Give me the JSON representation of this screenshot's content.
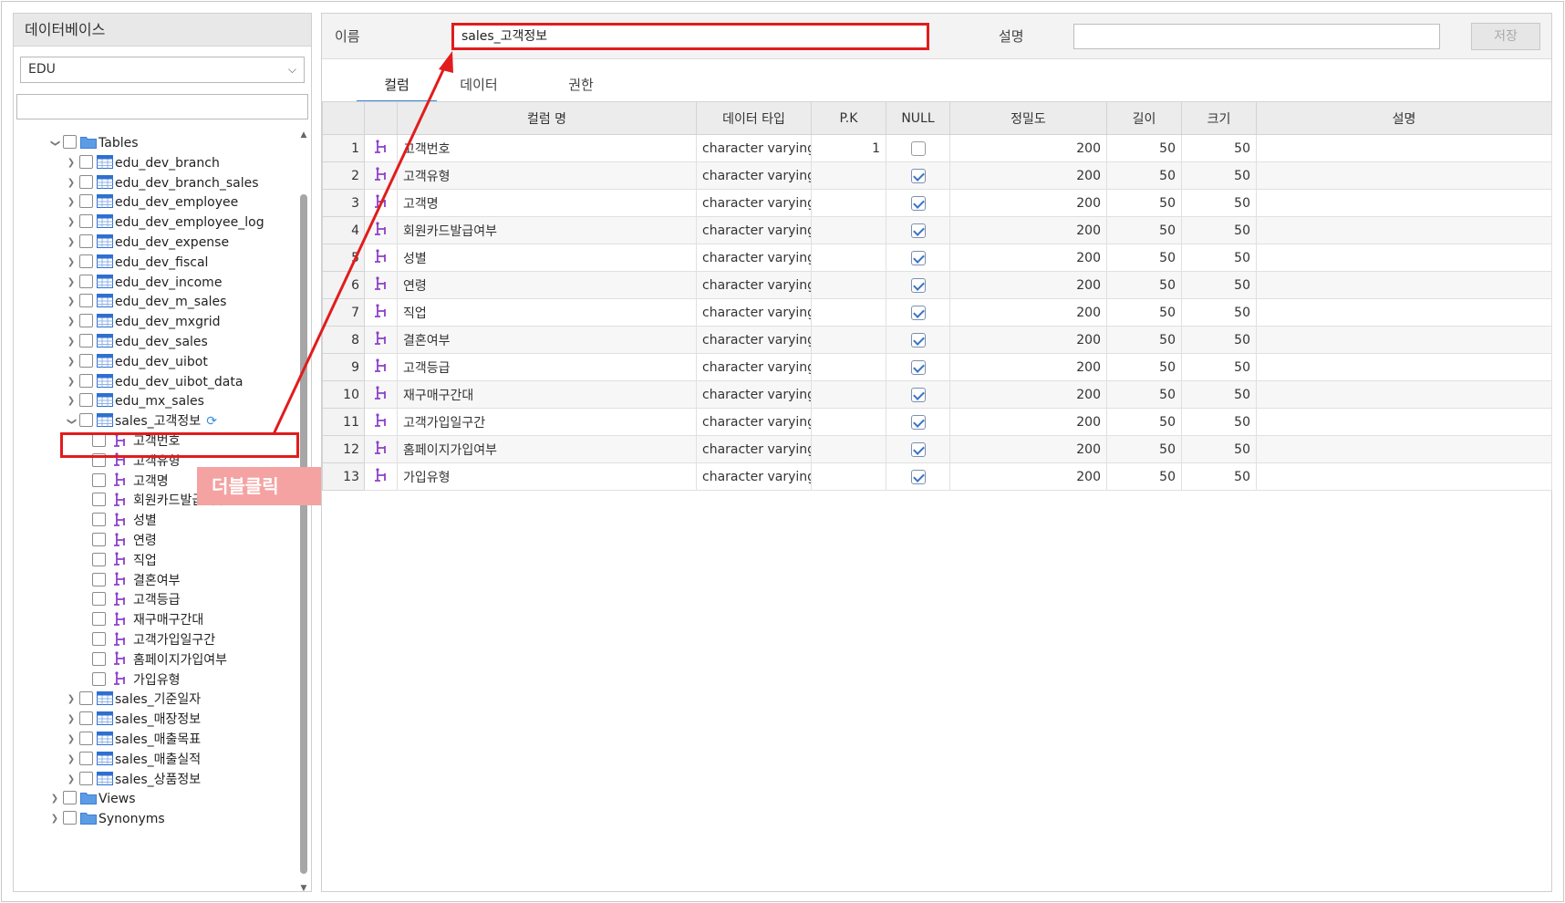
{
  "sidebar": {
    "title": "데이터베이스",
    "db_select": "EDU",
    "search_value": "",
    "tables_folder": "Tables",
    "tables_before": [
      "edu_dev_branch",
      "edu_dev_branch_sales",
      "edu_dev_employee",
      "edu_dev_employee_log",
      "edu_dev_expense",
      "edu_dev_fiscal",
      "edu_dev_income",
      "edu_dev_m_sales",
      "edu_dev_mxgrid",
      "edu_dev_sales",
      "edu_dev_uibot",
      "edu_dev_uibot_data",
      "edu_mx_sales"
    ],
    "selected_table": "sales_고객정보",
    "selected_columns": [
      "고객번호",
      "고객유형",
      "고객명",
      "회원카드발급여부",
      "성별",
      "연령",
      "직업",
      "결혼여부",
      "고객등급",
      "재구매구간대",
      "고객가입일구간",
      "홈페이지가입여부",
      "가입유형"
    ],
    "tables_after": [
      "sales_기준일자",
      "sales_매장정보",
      "sales_매출목표",
      "sales_매출실적",
      "sales_상품정보"
    ],
    "views_folder": "Views",
    "synonyms_folder": "Synonyms"
  },
  "annotation": {
    "double_click_label": "더블클릭"
  },
  "form": {
    "name_label": "이름",
    "name_value": "sales_고객정보",
    "desc_label": "설명",
    "desc_value": "",
    "save_label": "저장"
  },
  "tabs": [
    "컬럼",
    "데이터",
    "권한"
  ],
  "grid": {
    "headers": [
      "컬럼 명",
      "데이터 타입",
      "P.K",
      "NULL",
      "정밀도",
      "길이",
      "크기",
      "설명"
    ],
    "rows": [
      {
        "no": "1",
        "name": "고객번호",
        "type": "character varying",
        "pk": "1",
        "null": false,
        "precision": "200",
        "length": "50",
        "size": "50",
        "desc": ""
      },
      {
        "no": "2",
        "name": "고객유형",
        "type": "character varying",
        "pk": "",
        "null": true,
        "precision": "200",
        "length": "50",
        "size": "50",
        "desc": ""
      },
      {
        "no": "3",
        "name": "고객명",
        "type": "character varying",
        "pk": "",
        "null": true,
        "precision": "200",
        "length": "50",
        "size": "50",
        "desc": ""
      },
      {
        "no": "4",
        "name": "회원카드발급여부",
        "type": "character varying",
        "pk": "",
        "null": true,
        "precision": "200",
        "length": "50",
        "size": "50",
        "desc": ""
      },
      {
        "no": "5",
        "name": "성별",
        "type": "character varying",
        "pk": "",
        "null": true,
        "precision": "200",
        "length": "50",
        "size": "50",
        "desc": ""
      },
      {
        "no": "6",
        "name": "연령",
        "type": "character varying",
        "pk": "",
        "null": true,
        "precision": "200",
        "length": "50",
        "size": "50",
        "desc": ""
      },
      {
        "no": "7",
        "name": "직업",
        "type": "character varying",
        "pk": "",
        "null": true,
        "precision": "200",
        "length": "50",
        "size": "50",
        "desc": ""
      },
      {
        "no": "8",
        "name": "결혼여부",
        "type": "character varying",
        "pk": "",
        "null": true,
        "precision": "200",
        "length": "50",
        "size": "50",
        "desc": ""
      },
      {
        "no": "9",
        "name": "고객등급",
        "type": "character varying",
        "pk": "",
        "null": true,
        "precision": "200",
        "length": "50",
        "size": "50",
        "desc": ""
      },
      {
        "no": "10",
        "name": "재구매구간대",
        "type": "character varying",
        "pk": "",
        "null": true,
        "precision": "200",
        "length": "50",
        "size": "50",
        "desc": ""
      },
      {
        "no": "11",
        "name": "고객가입일구간",
        "type": "character varying",
        "pk": "",
        "null": true,
        "precision": "200",
        "length": "50",
        "size": "50",
        "desc": ""
      },
      {
        "no": "12",
        "name": "홈페이지가입여부",
        "type": "character varying",
        "pk": "",
        "null": true,
        "precision": "200",
        "length": "50",
        "size": "50",
        "desc": ""
      },
      {
        "no": "13",
        "name": "가입유형",
        "type": "character varying",
        "pk": "",
        "null": true,
        "precision": "200",
        "length": "50",
        "size": "50",
        "desc": ""
      }
    ]
  },
  "colors": {
    "highlight": "#e11c1c",
    "label_bg": "#f4a2a2",
    "tab_active": "#3a86d6",
    "column_icon": "#8e3fc9",
    "table_icon": "#2f6fd1"
  }
}
